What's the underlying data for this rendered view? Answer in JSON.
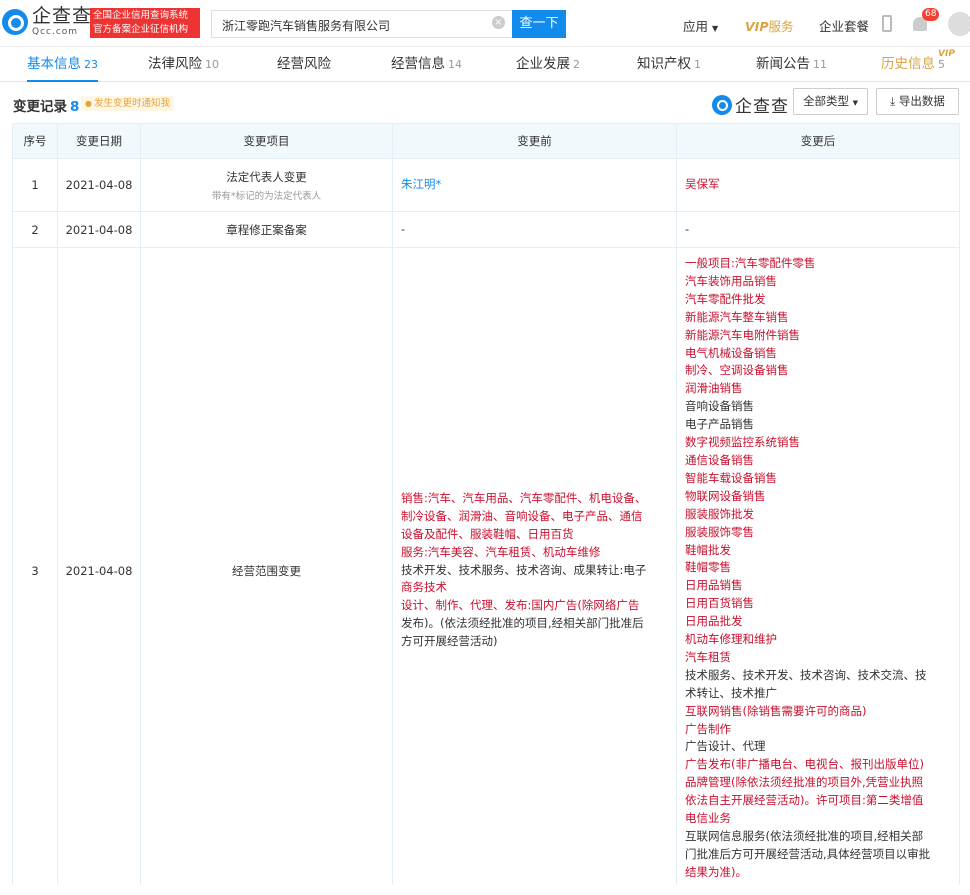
{
  "header": {
    "logo_cn": "企查查",
    "logo_en": "Qcc.com",
    "badge_line1": "全国企业信用查询系统",
    "badge_line2": "官方备案企业征信机构",
    "search_value": "浙江零跑汽车销售服务有限公司",
    "search_button": "查一下",
    "app_menu": "应用",
    "vip_label": "VIP",
    "vip_service": "服务",
    "enterprise_package": "企业套餐",
    "notification_count": "68"
  },
  "tabs": [
    {
      "label": "基本信息",
      "count": "23"
    },
    {
      "label": "法律风险",
      "count": "10"
    },
    {
      "label": "经营风险",
      "count": ""
    },
    {
      "label": "经营信息",
      "count": "14"
    },
    {
      "label": "企业发展",
      "count": "2"
    },
    {
      "label": "知识产权",
      "count": "1"
    },
    {
      "label": "新闻公告",
      "count": "11"
    },
    {
      "label": "历史信息",
      "count": "5"
    }
  ],
  "tab_vip_badge": "VIP",
  "section": {
    "title": "变更记录",
    "count": "8",
    "notify": "发生变更时通知我",
    "logo_text": "企查查",
    "filter_button": "全部类型",
    "export_button": "导出数据"
  },
  "table": {
    "headers": [
      "序号",
      "变更日期",
      "变更项目",
      "变更前",
      "变更后"
    ],
    "rows": [
      {
        "index": "1",
        "date": "2021-04-08",
        "item": "法定代表人变更",
        "item_note": "带有*标记的为法定代表人",
        "before": [
          {
            "t": "朱江明*",
            "c": "blue"
          }
        ],
        "after": [
          {
            "t": "吴保军",
            "c": "red"
          }
        ]
      },
      {
        "index": "2",
        "date": "2021-04-08",
        "item": "章程修正案备案",
        "item_note": "",
        "before": [
          {
            "t": "-",
            "c": "black"
          }
        ],
        "after": [
          {
            "t": "-",
            "c": "black"
          }
        ]
      },
      {
        "index": "3",
        "date": "2021-04-08",
        "item": "经营范围变更",
        "item_note": "",
        "before": [
          {
            "t": "销售:汽车、汽车用品、汽车零配件、机电设备、",
            "c": "red"
          },
          {
            "t": "制冷设备、润滑油、音响设备、电子产品、通信",
            "c": "red"
          },
          {
            "t": "设备及配件、服装鞋帽、日用百货",
            "c": "red"
          },
          {
            "t": "服务:汽车美容、汽车租赁、机动车维修",
            "c": "red"
          },
          {
            "t": "技术开发、技术服务、技术咨询、成果转让:电子",
            "c": "black"
          },
          {
            "t": "商务技术",
            "c": "red"
          },
          {
            "t": "设计、制作、代理、发布:国内广告(除网络广告",
            "c": "red"
          },
          {
            "t": "发布)。(依法须经批准的项目,经相关部门批准后",
            "c": "black"
          },
          {
            "t": "方可开展经营活动)",
            "c": "black"
          }
        ],
        "after": [
          {
            "t": "一般项目:汽车零配件零售",
            "c": "red"
          },
          {
            "t": "汽车装饰用品销售",
            "c": "red"
          },
          {
            "t": "汽车零配件批发",
            "c": "red"
          },
          {
            "t": "新能源汽车整车销售",
            "c": "red"
          },
          {
            "t": "新能源汽车电附件销售",
            "c": "red"
          },
          {
            "t": "电气机械设备销售",
            "c": "red"
          },
          {
            "t": "制冷、空调设备销售",
            "c": "red"
          },
          {
            "t": "润滑油销售",
            "c": "red"
          },
          {
            "t": "音响设备销售",
            "c": "black"
          },
          {
            "t": "电子产品销售",
            "c": "black"
          },
          {
            "t": "数字视频监控系统销售",
            "c": "red"
          },
          {
            "t": "通信设备销售",
            "c": "red"
          },
          {
            "t": "智能车载设备销售",
            "c": "red"
          },
          {
            "t": "物联网设备销售",
            "c": "red"
          },
          {
            "t": "服装服饰批发",
            "c": "red"
          },
          {
            "t": "服装服饰零售",
            "c": "red"
          },
          {
            "t": "鞋帽批发",
            "c": "red"
          },
          {
            "t": "鞋帽零售",
            "c": "red"
          },
          {
            "t": "日用品销售",
            "c": "red"
          },
          {
            "t": "日用百货销售",
            "c": "red"
          },
          {
            "t": "日用品批发",
            "c": "red"
          },
          {
            "t": "机动车修理和维护",
            "c": "red"
          },
          {
            "t": "汽车租赁",
            "c": "red"
          },
          {
            "t": "技术服务、技术开发、技术咨询、技术交流、技",
            "c": "black"
          },
          {
            "t": "术转让、技术推广",
            "c": "black"
          },
          {
            "t": "互联网销售(除销售需要许可的商品)",
            "c": "red"
          },
          {
            "t": "广告制作",
            "c": "red"
          },
          {
            "t": "广告设计、代理",
            "c": "black"
          },
          {
            "t": "广告发布(非广播电台、电视台、报刊出版单位)",
            "c": "red"
          },
          {
            "t": "品牌管理(除依法须经批准的项目外,凭营业执照",
            "c": "red"
          },
          {
            "t": "依法自主开展经营活动)。许可项目:第二类增值",
            "c": "red"
          },
          {
            "t": "电信业务",
            "c": "red"
          },
          {
            "t": "互联网信息服务(依法须经批准的项目,经相关部",
            "c": "black"
          },
          {
            "t": "门批准后方可开展经营活动,具体经营项目以审批",
            "c": "black"
          },
          {
            "t": "结果为准)。",
            "c": "red"
          }
        ]
      }
    ]
  }
}
